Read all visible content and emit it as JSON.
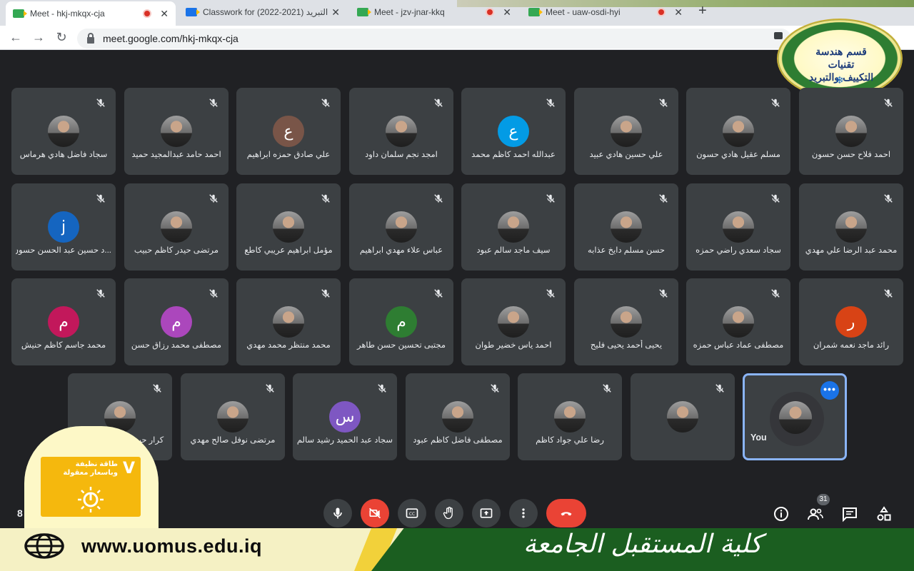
{
  "browser": {
    "tabs": [
      {
        "title": "Meet - hkj-mkqx-cja",
        "recording": true,
        "active": true
      },
      {
        "title": "Classwork for (2022-2021) التبريد",
        "recording": false,
        "active": false
      },
      {
        "title": "Meet - jzv-jnar-kkq",
        "recording": true,
        "active": false
      },
      {
        "title": "Meet - uaw-osdi-hyi",
        "recording": true,
        "active": false
      }
    ],
    "new_tab": "+",
    "url": "meet.google.com/hkj-mkqx-cja"
  },
  "logo": {
    "text_line1": "قسم هندسة تقنيات",
    "text_line2": "التكييف والتبريد"
  },
  "participants": [
    {
      "name": "احمد فلاح حسن حسون",
      "avatar": "photo"
    },
    {
      "name": "مسلم عقيل هادي حسون",
      "avatar": "photo"
    },
    {
      "name": "علي حسين هادي عبيد",
      "avatar": "photo"
    },
    {
      "name": "عبدالله احمد كاظم محمد",
      "avatar": "letter",
      "letter": "ع",
      "color": "#039be5"
    },
    {
      "name": "امجد نجم سلمان داود",
      "avatar": "photo"
    },
    {
      "name": "علي صادق حمزه ابراهيم",
      "avatar": "letter",
      "letter": "ع",
      "color": "#795548"
    },
    {
      "name": "احمد حامد عبدالمجيد حميد",
      "avatar": "photo"
    },
    {
      "name": "سجاد فاضل هادي هرماس",
      "avatar": "photo"
    },
    {
      "name": "محمد عبد الرضا علي مهدي",
      "avatar": "photo"
    },
    {
      "name": "سجاد سعدي راضي حمزه",
      "avatar": "photo"
    },
    {
      "name": "حسن مسلم دايخ عذابه",
      "avatar": "photo"
    },
    {
      "name": "سيف ماجد سالم عبود",
      "avatar": "photo"
    },
    {
      "name": "عباس علاء مهدي ابراهيم",
      "avatar": "photo"
    },
    {
      "name": "مؤمل ابراهيم عريبي كاطع",
      "avatar": "photo"
    },
    {
      "name": "مرتضى حيدر كاظم حبيب",
      "avatar": "photo"
    },
    {
      "name": "...د حسين عبد الحسن حسون",
      "avatar": "letter",
      "letter": "j",
      "color": "#1565c0"
    },
    {
      "name": "رائد ماجد نعمه شمران",
      "avatar": "letter",
      "letter": "ر",
      "color": "#d84315"
    },
    {
      "name": "مصطفى عماد عباس حمزه",
      "avatar": "photo"
    },
    {
      "name": "يحيى أحمد يحيى فليح",
      "avatar": "photo"
    },
    {
      "name": "احمد ياس خضير طوان",
      "avatar": "photo"
    },
    {
      "name": "مجتبى تحسين حسن طاهر",
      "avatar": "letter",
      "letter": "م",
      "color": "#2e7d32"
    },
    {
      "name": "محمد منتظر محمد مهدي",
      "avatar": "photo"
    },
    {
      "name": "مصطفى محمد رزاق حسن",
      "avatar": "letter",
      "letter": "م",
      "color": "#ab47bc"
    },
    {
      "name": "محمد جاسم كاظم حنيش",
      "avatar": "letter",
      "letter": "م",
      "color": "#c2185b"
    },
    {
      "name": "",
      "avatar": "photo"
    },
    {
      "name": "رضا علي جواد كاظم",
      "avatar": "photo"
    },
    {
      "name": "مصطفى فاضل كاظم عبود",
      "avatar": "photo"
    },
    {
      "name": "سجاد عبد الحميد رشيد سالم",
      "avatar": "letter",
      "letter": "س",
      "color": "#7e57c2"
    },
    {
      "name": "مرتضى نوفل صالح مهدي",
      "avatar": "photo"
    },
    {
      "name": "كرار حيدر علي عبد الكريم",
      "avatar": "photo"
    }
  ],
  "self_tile": {
    "label": "You",
    "more": "•••"
  },
  "controls": {
    "time_partial": "8",
    "people_count": "31",
    "labels": [
      "mic",
      "camera-off",
      "captions",
      "raise-hand",
      "present",
      "more",
      "leave-call",
      "info",
      "people",
      "chat",
      "activities"
    ]
  },
  "promo": {
    "badge_letter": "V",
    "text": "طاقة نظيفة وباسعار معقولة"
  },
  "footer": {
    "url": "www.uomus.edu.iq",
    "college": "كلية المستقبل الجامعة"
  },
  "colors": {
    "meet_bg": "#202124",
    "tile_bg": "#3c4043",
    "hangup_red": "#ea4335",
    "self_border": "#8ab4f8",
    "footer_green": "#1b5e20",
    "promo_yellow": "#f5b80d"
  }
}
